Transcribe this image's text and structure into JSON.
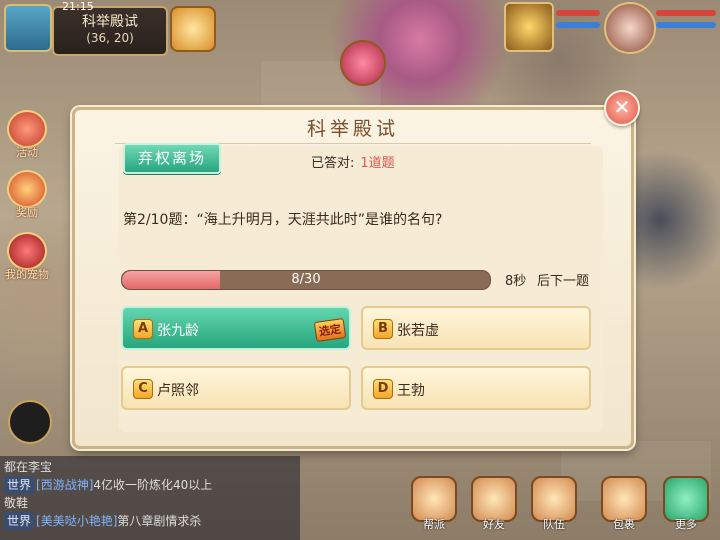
{
  "hud": {
    "clock": "21:15",
    "location_name": "科举殿试",
    "location_coords": "(36, 20)",
    "side_buttons": [
      "活动",
      "奖励",
      "我的宠物"
    ],
    "bottom_buttons": [
      "帮派",
      "好友",
      "队伍",
      "包裹",
      "更多"
    ]
  },
  "chat": {
    "lines": [
      {
        "text": "都在李宝"
      },
      {
        "channel": "世界",
        "name": "[西游战神]",
        "text": "4亿收一阶炼化40以上"
      },
      {
        "text": "敬鞋"
      },
      {
        "channel": "世界",
        "name": "[美美哒小艳艳]",
        "text": "第八章剧情求杀"
      }
    ]
  },
  "dialog": {
    "title": "科举殿试",
    "quit_label": "弃权离场",
    "answered_label": "已答对:",
    "answered_value": "1道题",
    "question": "第2/10题：“海上升明月，天涯共此时”是谁的名句?",
    "progress_text": "8/30",
    "progress_fraction": 0.267,
    "timer": "8秒",
    "next_label": "后下一题",
    "close_label": "✕",
    "options": [
      {
        "letter": "A",
        "text": "张九龄",
        "selected": true,
        "badge": "选定"
      },
      {
        "letter": "B",
        "text": "张若虚",
        "selected": false
      },
      {
        "letter": "C",
        "text": "卢照邻",
        "selected": false
      },
      {
        "letter": "D",
        "text": "王勃",
        "selected": false
      }
    ]
  },
  "colors": {
    "accent_green": "#28a57f",
    "progress_red": "#e46767",
    "answer_count": "#e2554e"
  }
}
